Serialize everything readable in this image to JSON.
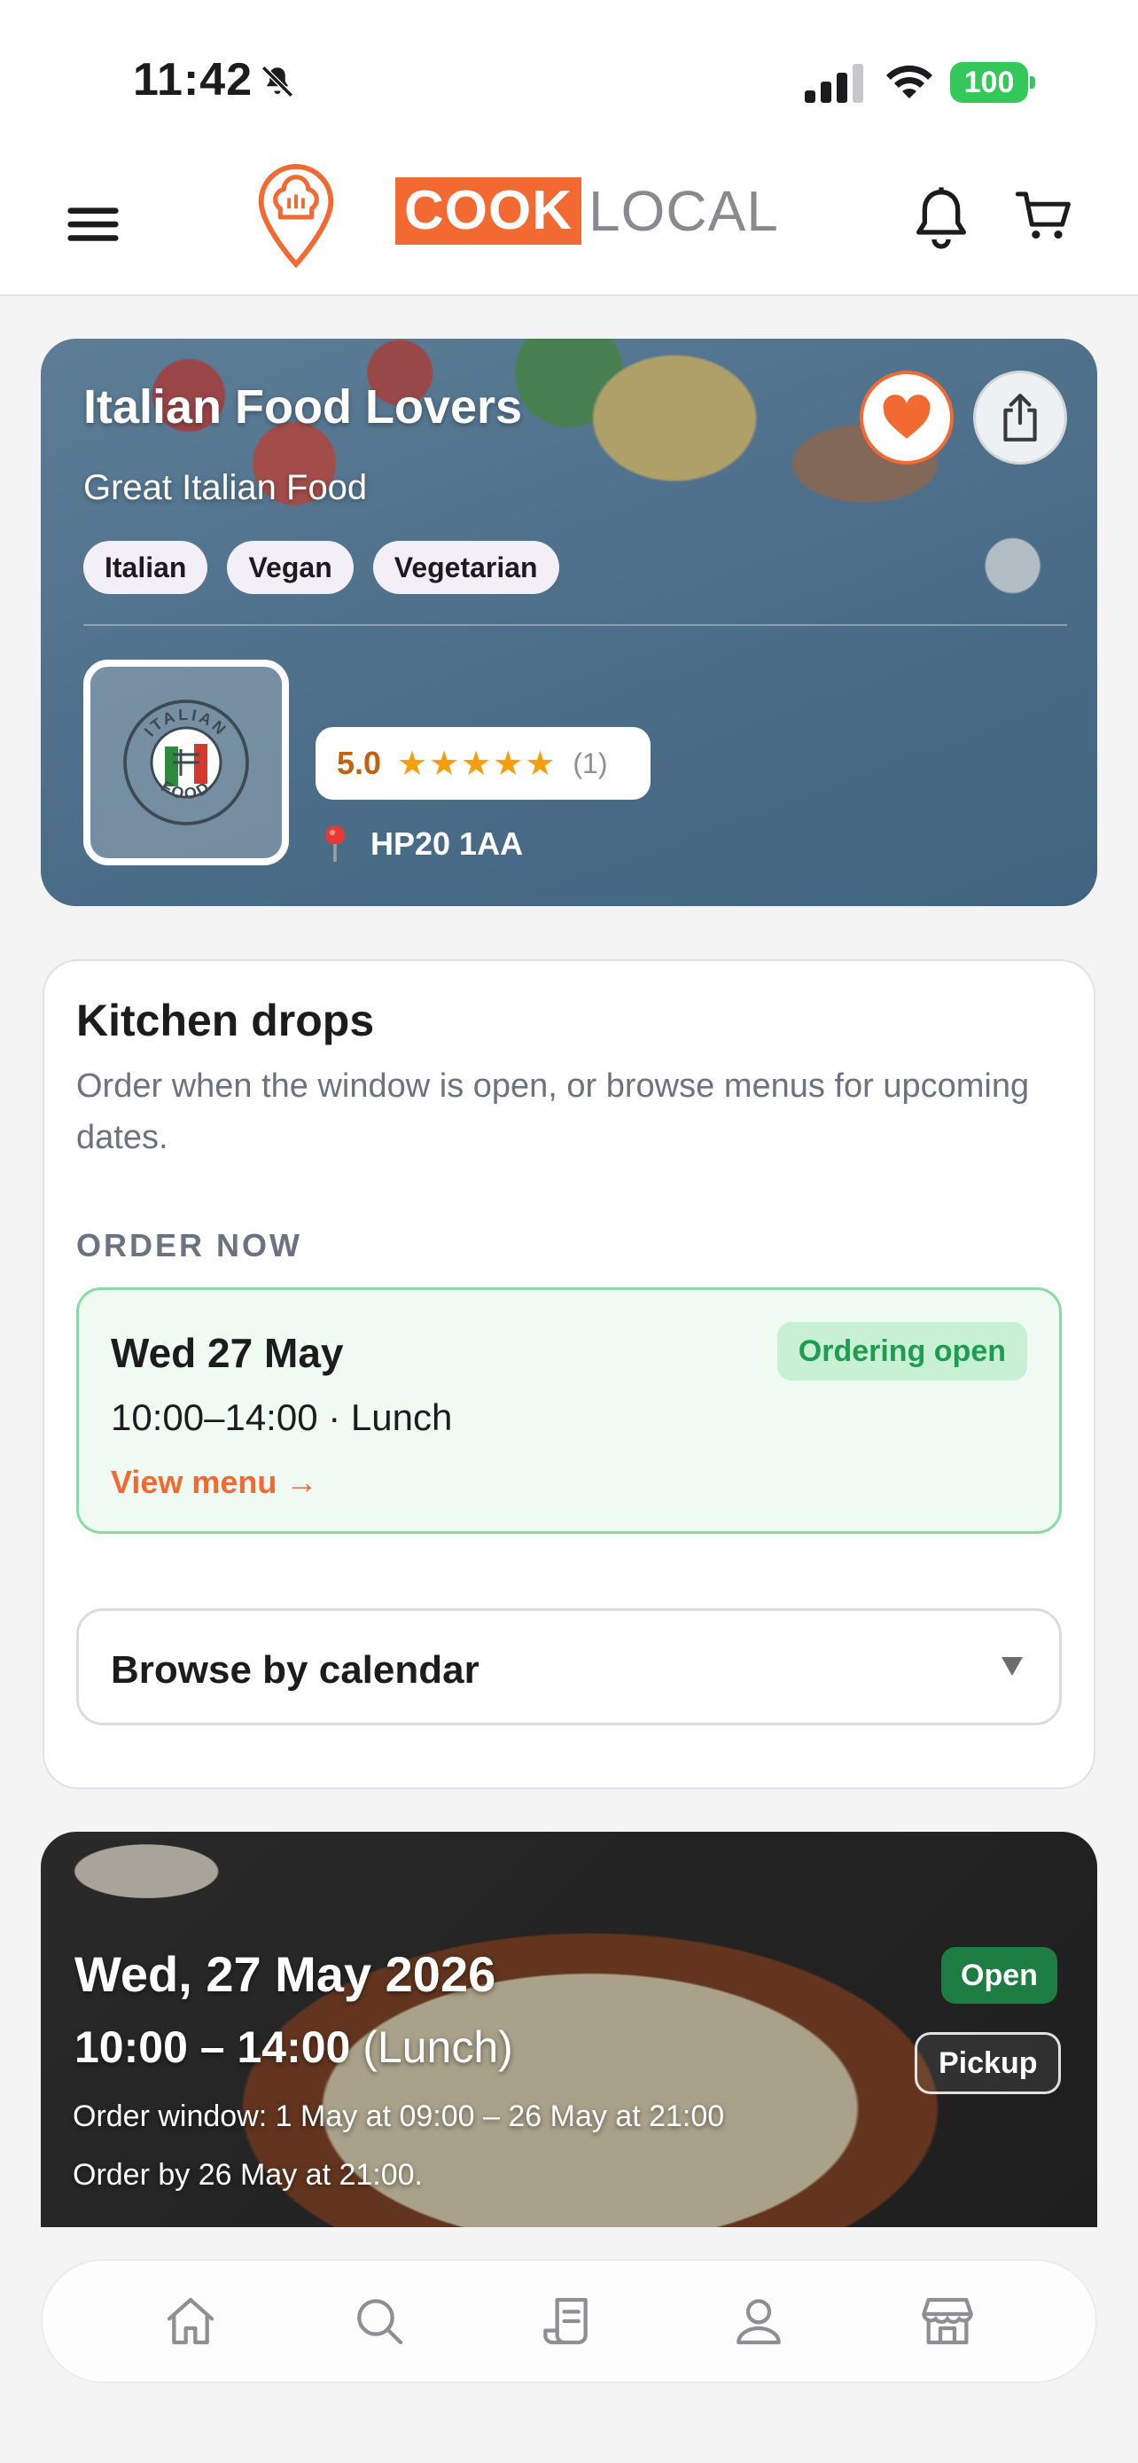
{
  "status_bar": {
    "time": "11:42",
    "battery": "100"
  },
  "header": {
    "brand_part1": "COOK",
    "brand_part2": "LOCAL"
  },
  "kitchen": {
    "name": "Italian Food Lovers",
    "tagline": "Great Italian Food",
    "tags": [
      "Italian",
      "Vegan",
      "Vegetarian"
    ],
    "rating": "5.0",
    "stars": "★★★★★",
    "review_count": "(1)",
    "postcode": "HP20 1AA",
    "logo_top_text": "ITALIAN",
    "logo_bottom_text": "FOOD"
  },
  "drops": {
    "title": "Kitchen drops",
    "description": "Order when the window is open, or browse menus for upcoming dates.",
    "section_label": "ORDER NOW",
    "slot": {
      "date": "Wed 27 May",
      "time": "10:00–14:00 · Lunch",
      "badge": "Ordering open",
      "link": "View menu →"
    },
    "calendar_label": "Browse by calendar"
  },
  "event": {
    "date": "Wed, 27 May 2026",
    "time_range": "10:00 – 14:00",
    "meal": "(Lunch)",
    "order_window": "Order window: 1 May at 09:00 – 26 May at 21:00",
    "order_by": "Order by 26 May at 21:00.",
    "status": "Open",
    "fulfilment": "Pickup"
  },
  "tabs": [
    {
      "icon": "home-icon"
    },
    {
      "icon": "search-icon"
    },
    {
      "icon": "orders-receipt-icon"
    },
    {
      "icon": "profile-icon"
    },
    {
      "icon": "store-icon"
    }
  ],
  "colors": {
    "accent": "#f26a32",
    "open_green": "#1f9d4f",
    "slot_bg": "#effaf3"
  }
}
